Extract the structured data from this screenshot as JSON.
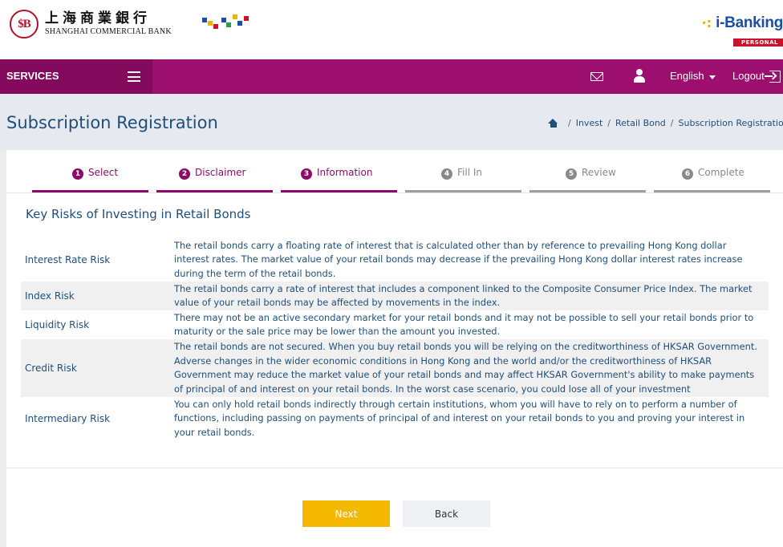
{
  "brand": {
    "seal": "$B",
    "chinese_name": "上海商業銀行",
    "english_name": "SHANGHAI COMMERCIAL BANK",
    "ibanking_dots": "·:",
    "ibanking_name": "i-Banking",
    "ibanking_tag": "PERSONAL",
    "colors": {
      "primary": "#9c0f6f",
      "services_bg": "#82095b",
      "accent_red": "#b0122a",
      "ibanking_blue": "#1a4fa3",
      "next_button": "#f5b800"
    }
  },
  "nav": {
    "services_label": "SERVICES",
    "menu_icon": "hamburger-icon",
    "mail_icon": "mail-icon",
    "user_icon": "user-icon",
    "language": "English",
    "logout": "Logout"
  },
  "page": {
    "title": "Subscription Registration",
    "breadcrumb": [
      "Invest",
      "Retail Bond",
      "Subscription Registration"
    ]
  },
  "steps": [
    {
      "num": "1",
      "label": "Select",
      "state": "done"
    },
    {
      "num": "2",
      "label": "Disclaimer",
      "state": "done"
    },
    {
      "num": "3",
      "label": "Information",
      "state": "current"
    },
    {
      "num": "4",
      "label": "Fill In",
      "state": "pending"
    },
    {
      "num": "5",
      "label": "Review",
      "state": "pending"
    },
    {
      "num": "6",
      "label": "Complete",
      "state": "pending"
    }
  ],
  "section_title": "Key Risks of Investing in Retail Bonds",
  "risks": [
    {
      "name": "Interest Rate Risk",
      "description": "The retail bonds carry a floating rate of interest that is calculated other than by reference to prevailing Hong Kong dollar interest rates. The market value of your retail bonds may decrease if the prevailing Hong Kong dollar interest rates increase during the term of the retail bonds."
    },
    {
      "name": "Index Risk",
      "description": "The retail bonds carry a rate of interest that includes a component linked to the Composite Consumer Price Index. The market value of your retail bonds may be affected by movements in the index."
    },
    {
      "name": "Liquidity Risk",
      "description": "There may not be an active secondary market for your retail bonds and it may not be possible to sell your retail bonds prior to maturity or the sale price may be lower than the amount you invested."
    },
    {
      "name": "Credit Risk",
      "description": "The retail bonds are not secured. When you buy retail bonds you will be relying on the creditworthiness of HKSAR Government. Adverse changes in the wider economic conditions in Hong Kong and the world and/or the creditworthiness of HKSAR Government may reduce the market value of your retail bonds and may affect HKSAR Government's ability to make payments of principal of and interest on your retail bonds. In the worst case scenario, you could lose all of your investment"
    },
    {
      "name": "Intermediary Risk",
      "description": "You can only hold retail bonds indirectly through certain institutions, whom you will have to rely on to perform a number of functions, including passing on payments of principal of and interest on your retail bonds to you and proving your interest in your retail bonds."
    }
  ],
  "buttons": {
    "next": "Next",
    "back": "Back"
  }
}
